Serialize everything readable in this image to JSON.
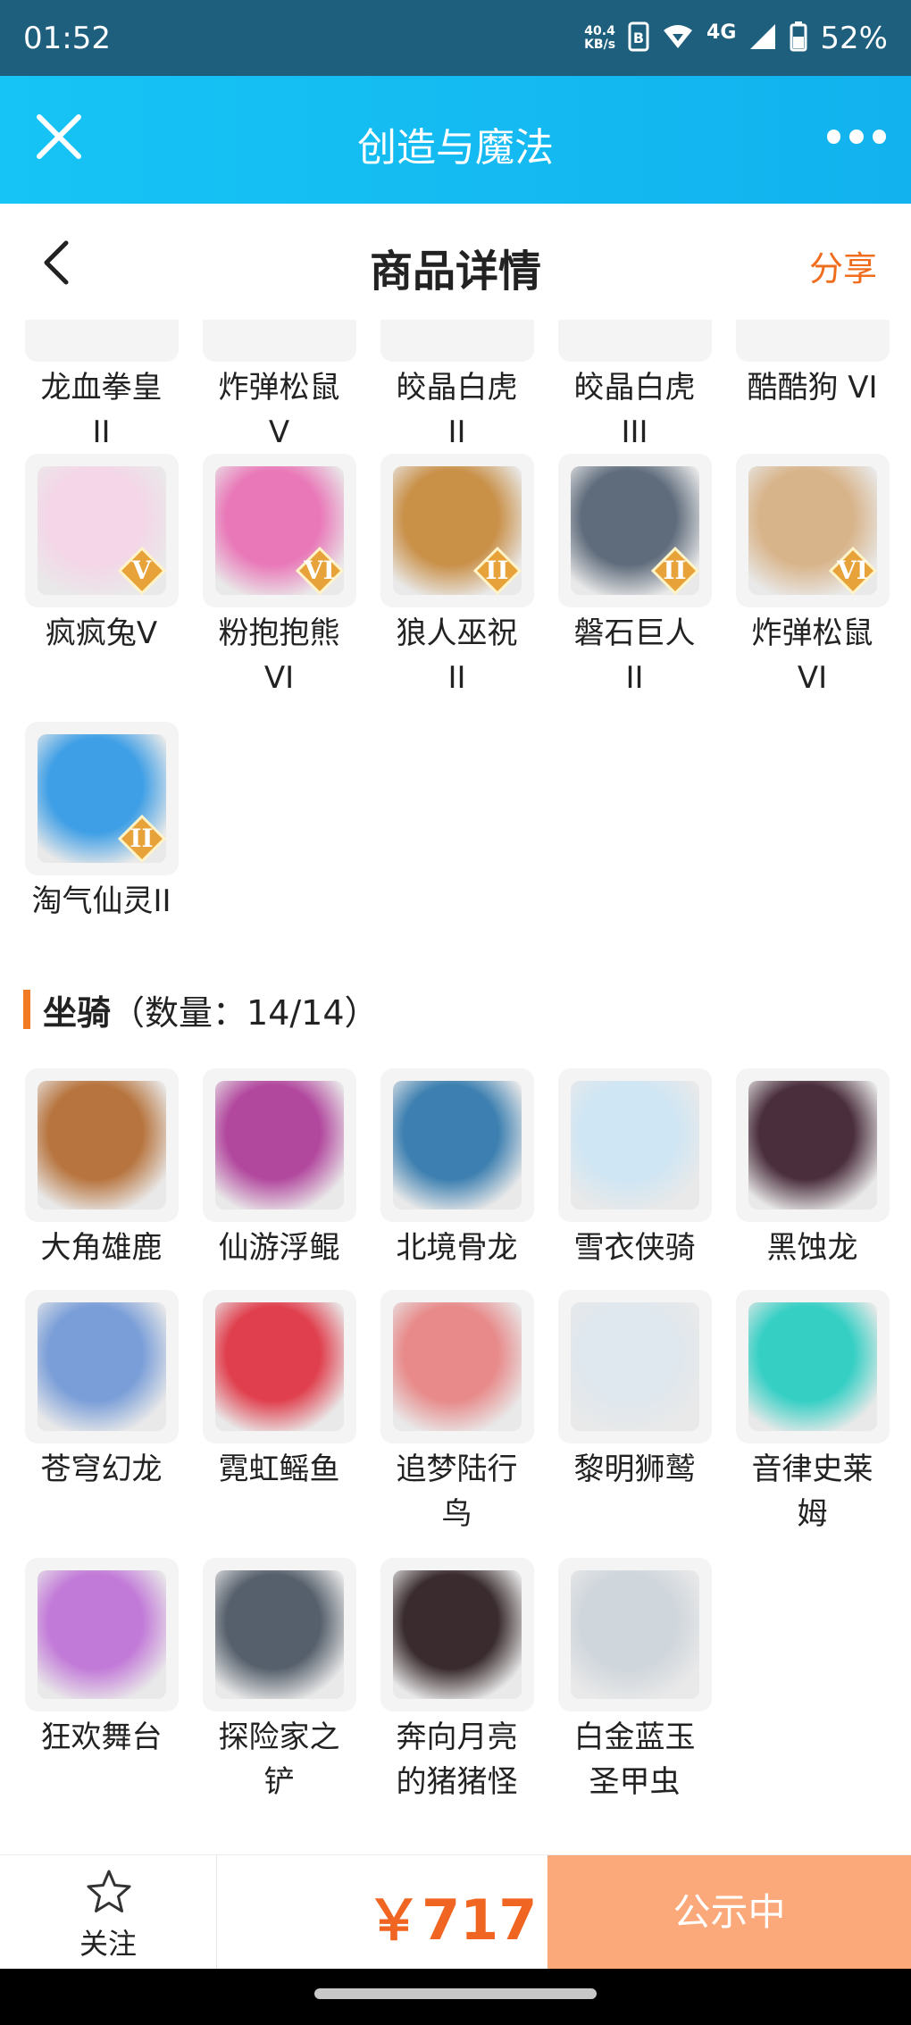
{
  "status_bar": {
    "time": "01:52",
    "net_speed_value": "40.4",
    "net_speed_unit": "KB/s",
    "network": "4G",
    "battery": "52%"
  },
  "app_bar": {
    "title": "创造与魔法"
  },
  "nav": {
    "title": "商品详情",
    "share": "分享"
  },
  "top_row": [
    {
      "label": "龙血拳皇 II"
    },
    {
      "label": "炸弹松鼠 V"
    },
    {
      "label": "皎晶白虎 II"
    },
    {
      "label": "皎晶白虎 III"
    },
    {
      "label": "酷酷狗 VI"
    }
  ],
  "pets": [
    {
      "label": "疯疯兔V",
      "badge": "V",
      "color": "#f4d6e8"
    },
    {
      "label": "粉抱抱熊 VI",
      "badge": "VI",
      "color": "#e978b8"
    },
    {
      "label": "狼人巫祝 II",
      "badge": "II",
      "color": "#c99048"
    },
    {
      "label": "磐石巨人 II",
      "badge": "II",
      "color": "#5f6c7c"
    },
    {
      "label": "炸弹松鼠 VI",
      "badge": "VI",
      "color": "#d8b48a"
    },
    {
      "label": "淘气仙灵II",
      "badge": "II",
      "color": "#3f9fe6"
    }
  ],
  "section": {
    "title": "坐骑",
    "count": "（数量：14/14）"
  },
  "mounts": [
    {
      "label": "大角雄鹿",
      "color": "#b7743e"
    },
    {
      "label": "仙游浮鲲",
      "color": "#b2489e"
    },
    {
      "label": "北境骨龙",
      "color": "#3c7fb0"
    },
    {
      "label": "雪衣侠骑",
      "color": "#cfe6f4"
    },
    {
      "label": "黑蚀龙",
      "color": "#4a2e3c"
    },
    {
      "label": "苍穹幻龙",
      "color": "#7a9ed8"
    },
    {
      "label": "霓虹鳐鱼",
      "color": "#e0404e"
    },
    {
      "label": "追梦陆行鸟",
      "color": "#e88a8a"
    },
    {
      "label": "黎明狮鹫",
      "color": "#dfe8ee"
    },
    {
      "label": "音律史莱姆",
      "color": "#35cfc4"
    },
    {
      "label": "狂欢舞台",
      "color": "#c27ad8"
    },
    {
      "label": "探险家之铲",
      "color": "#56606c"
    },
    {
      "label": "奔向月亮的猪猪怪",
      "color": "#3a2c2e"
    },
    {
      "label": "白金蓝玉圣甲虫",
      "color": "#cfd6dc"
    }
  ],
  "bottom": {
    "follow": "关注",
    "price": "￥717",
    "action": "公示中"
  }
}
